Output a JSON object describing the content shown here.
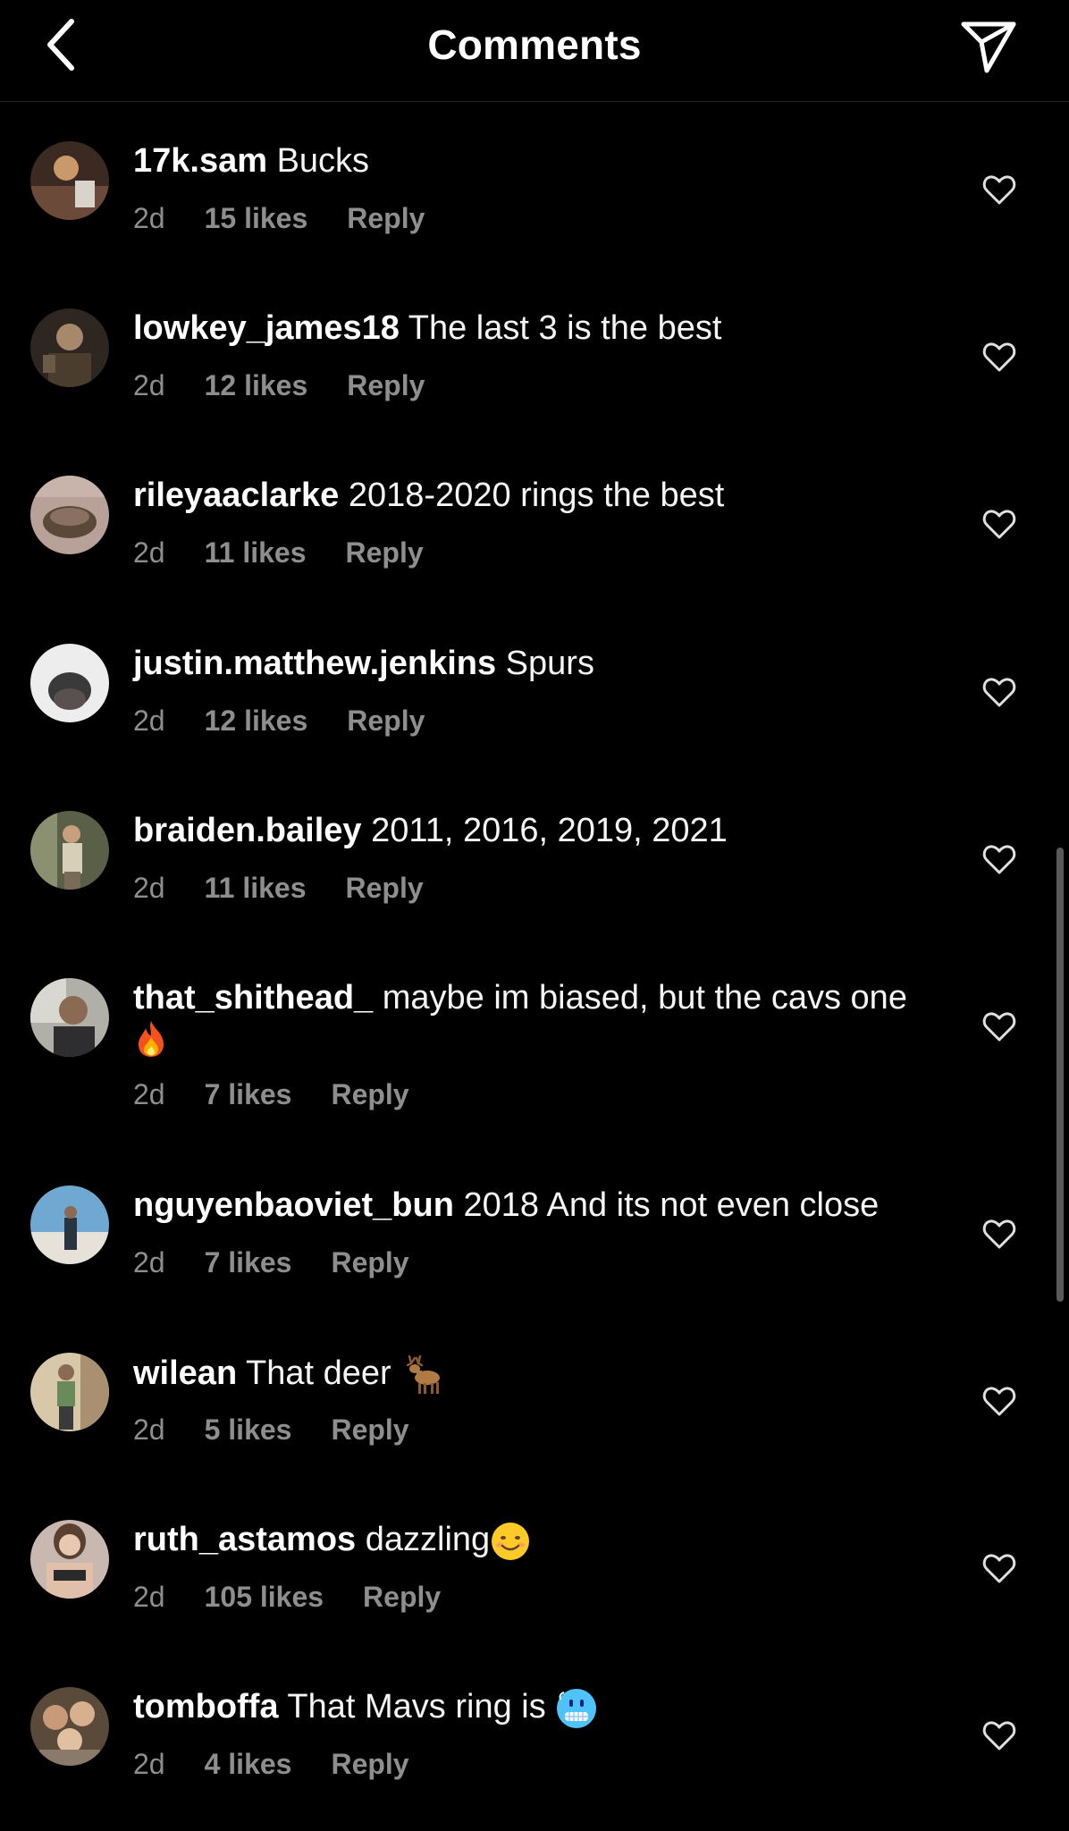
{
  "header": {
    "title": "Comments",
    "back_icon": "chevron-left-icon",
    "share_icon": "paper-plane-icon"
  },
  "comments": [
    {
      "username": "17k.sam",
      "text": "Bucks",
      "time": "2d",
      "likes": "15 likes",
      "reply": "Reply",
      "avatar_color": "#6b4a3a"
    },
    {
      "username": "lowkey_james18",
      "text": "The last 3 is the best",
      "time": "2d",
      "likes": "12 likes",
      "reply": "Reply",
      "avatar_color": "#4a3d2e"
    },
    {
      "username": "rileyaaclarke",
      "text": "2018-2020 rings the best",
      "time": "2d",
      "likes": "11 likes",
      "reply": "Reply",
      "avatar_color": "#a3847a"
    },
    {
      "username": "justin.matthew.jenkins",
      "text": "Spurs",
      "time": "2d",
      "likes": "12 likes",
      "reply": "Reply",
      "avatar_color": "#e8e8e8"
    },
    {
      "username": "braiden.bailey",
      "text": "2011, 2016, 2019, 2021",
      "time": "2d",
      "likes": "11 likes",
      "reply": "Reply",
      "avatar_color": "#7d7463"
    },
    {
      "username": "that_shithead_",
      "text": "maybe im biased, but the cavs one",
      "emoji": "fire-emoji",
      "time": "2d",
      "likes": "7 likes",
      "reply": "Reply",
      "avatar_color": "#9a9a92"
    },
    {
      "username": "nguyenbaoviet_bun",
      "text": "2018 And its not even close",
      "time": "2d",
      "likes": "7 likes",
      "reply": "Reply",
      "avatar_color": "#4c7fa6"
    },
    {
      "username": "wilean",
      "text": "That deer",
      "emoji": "deer-emoji",
      "time": "2d",
      "likes": "5 likes",
      "reply": "Reply",
      "avatar_color": "#b9a68a"
    },
    {
      "username": "ruth_astamos",
      "text": "dazzling",
      "emoji": "smiling-face-emoji",
      "time": "2d",
      "likes": "105 likes",
      "reply": "Reply",
      "avatar_color": "#b8a39a"
    },
    {
      "username": "tomboffa",
      "text": "That Mavs ring is",
      "emoji": "cold-face-emoji",
      "time": "2d",
      "likes": "4 likes",
      "reply": "Reply",
      "avatar_color": "#7a6a5a"
    }
  ]
}
